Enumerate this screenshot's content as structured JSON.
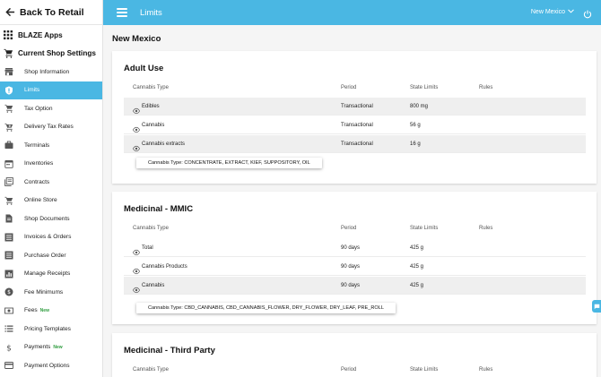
{
  "sidebar": {
    "back_label": "Back To Retail",
    "apps_label": "BLAZE Apps",
    "settings_label": "Current Shop Settings",
    "items": [
      {
        "label": "Shop Information",
        "icon": "store-icon",
        "active": false,
        "badge": ""
      },
      {
        "label": "Limits",
        "icon": "shield-icon",
        "active": true,
        "badge": ""
      },
      {
        "label": "Tax Option",
        "icon": "cart-icon",
        "active": false,
        "badge": ""
      },
      {
        "label": "Delivery Tax Rates",
        "icon": "cart-plus-icon",
        "active": false,
        "badge": ""
      },
      {
        "label": "Terminals",
        "icon": "briefcase-icon",
        "active": false,
        "badge": ""
      },
      {
        "label": "Inventories",
        "icon": "calendar-icon",
        "active": false,
        "badge": ""
      },
      {
        "label": "Contracts",
        "icon": "library-icon",
        "active": false,
        "badge": ""
      },
      {
        "label": "Online Store",
        "icon": "cart-icon",
        "active": false,
        "badge": ""
      },
      {
        "label": "Shop Documents",
        "icon": "document-icon",
        "active": false,
        "badge": ""
      },
      {
        "label": "Invoices & Orders",
        "icon": "list-box-icon",
        "active": false,
        "badge": ""
      },
      {
        "label": "Purchase Order",
        "icon": "list-box-icon",
        "active": false,
        "badge": ""
      },
      {
        "label": "Manage Receipts",
        "icon": "receipt-chart-icon",
        "active": false,
        "badge": ""
      },
      {
        "label": "Fee Minimums",
        "icon": "coin-icon",
        "active": false,
        "badge": ""
      },
      {
        "label": "Fees",
        "icon": "money-icon",
        "active": false,
        "badge": "New"
      },
      {
        "label": "Pricing Templates",
        "icon": "list-icon",
        "active": false,
        "badge": ""
      },
      {
        "label": "Payments",
        "icon": "dollar-icon",
        "active": false,
        "badge": "New"
      },
      {
        "label": "Payment Options",
        "icon": "credit-card-icon",
        "active": false,
        "badge": ""
      }
    ]
  },
  "topbar": {
    "title": "Limits",
    "state_selector": "New Mexico"
  },
  "page": {
    "title": "New Mexico"
  },
  "columns": {
    "type": "Cannabis Type",
    "period": "Period",
    "state_limits": "State Limits",
    "rules": "Rules"
  },
  "sections": [
    {
      "title": "Adult Use",
      "rows": [
        {
          "type": "Edibles",
          "period": "Transactional",
          "limit": "800 mg",
          "rules": ""
        },
        {
          "type": "Cannabis",
          "period": "Transactional",
          "limit": "56 g",
          "rules": ""
        },
        {
          "type": "Cannabis extracts",
          "period": "Transactional",
          "limit": "16 g",
          "rules": ""
        }
      ],
      "tooltip": "Cannabis Type: CONCENTRATE, EXTRACT, KIEF, SUPPOSITORY, OIL"
    },
    {
      "title": "Medicinal - MMIC",
      "rows": [
        {
          "type": "Total",
          "period": "90 days",
          "limit": "425 g",
          "rules": ""
        },
        {
          "type": "Cannabis Products",
          "period": "90 days",
          "limit": "425 g",
          "rules": ""
        },
        {
          "type": "Cannabis",
          "period": "90 days",
          "limit": "425 g",
          "rules": ""
        }
      ],
      "tooltip": "Cannabis Type: CBD_CANNABIS, CBD_CANNABIS_FLOWER, DRY_FLOWER, DRY_LEAF, PRE_ROLL"
    },
    {
      "title": "Medicinal - Third Party",
      "rows": [],
      "tooltip": ""
    }
  ],
  "colors": {
    "accent": "#4ab7e3",
    "badge_new": "#2e9c3e",
    "row_shade": "#efefef"
  }
}
